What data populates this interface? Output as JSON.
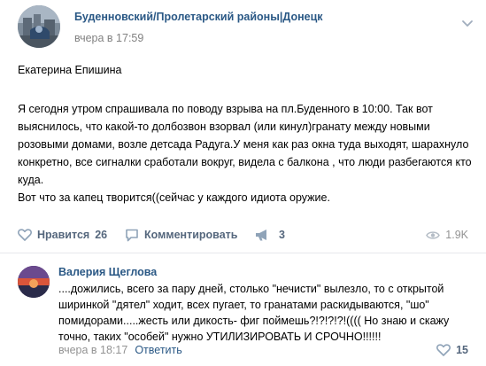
{
  "post": {
    "author": "Буденновский/Пролетарский районы|Донецк",
    "date": "вчера в 17:59",
    "signature": "Екатерина Епишина",
    "text": "Я сегодня утром спрашивала по поводу взрыва на пл.Буденного в 10:00. Так вот выяснилось, что какой-то долбозвон взорвал (или кинул)гранату между новыми розовыми домами, возле детсада Радуга.У меня как раз окна туда выходят, шарахнуло конкретно, все сигналки сработали вокруг, видела с балкона , что люди разбегаются кто куда.\nВот что за капец творится((сейчас у каждого идиота оружие."
  },
  "actions": {
    "like_label": "Нравится",
    "like_count": "26",
    "comment_label": "Комментировать",
    "share_count": "3",
    "views_count": "1.9K"
  },
  "comment": {
    "author": "Валерия Щеглова",
    "text": "....дожились, всего за пару дней, столько \"нечисти\" вылезло, то с открытой ширинкой \"дятел\" ходит, всех пугает, то гранатами раскидываются, \"шо\" помидорами.....жесть или дикость- фиг поймешь?!?!?!?!(((( Но знаю и скажу точно, таких \"особей\" нужно УТИЛИЗИРОВАТЬ И СРОЧНО!!!!!!",
    "date": "вчера в 18:17",
    "reply_label": "Ответить",
    "like_count": "15"
  },
  "colors": {
    "link": "#2a5885",
    "action": "#55677d",
    "muted": "#939393",
    "divider": "#e7e8ec"
  },
  "icons": [
    "more-icon",
    "heart-icon",
    "comment-icon",
    "share-megaphone-icon",
    "eye-icon"
  ]
}
